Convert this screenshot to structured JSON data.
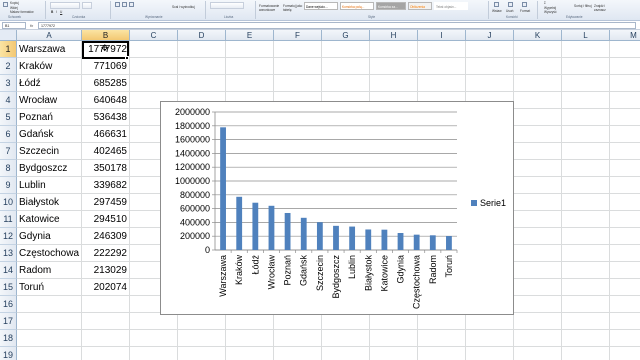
{
  "ribbon": {
    "clipboard_items": [
      "Kopiuj",
      "Wklej",
      "Malarz formatów"
    ],
    "group_labels": [
      "Schowek",
      "Czcionka",
      "Wyrównanie",
      "Liczba",
      "Style",
      "Komórki",
      "Edytowanie"
    ],
    "wrap_text": "Scal i wyśrodkuj",
    "conditional_formatting": "Formatowanie warunkowe",
    "format_as_table": "Formatuj jako tabelę",
    "styles": [
      "Dane wejścio...",
      "Komórka połą...",
      "Komórka za...",
      "Obliczenia",
      "Tekst objaśn..."
    ],
    "cells_buttons": [
      "Wstaw",
      "Usuń",
      "Format"
    ],
    "editing_items": [
      "Wypełnij",
      "Wyczyść",
      "Sortuj i filtruj",
      "Znajdź i zaznacz"
    ]
  },
  "formula_bar": {
    "name_box": "B1",
    "fx": "fx",
    "value": "1777972"
  },
  "grid": {
    "columns": [
      "A",
      "B",
      "C",
      "D",
      "E",
      "F",
      "G",
      "H",
      "I",
      "J",
      "K",
      "L",
      "M"
    ],
    "rows": [
      "1",
      "2",
      "3",
      "4",
      "5",
      "6",
      "7",
      "8",
      "9",
      "10",
      "11",
      "12",
      "13",
      "14",
      "15",
      "16",
      "17",
      "18",
      "19"
    ],
    "data": [
      {
        "city": "Warszawa",
        "value": "1777972"
      },
      {
        "city": "Kraków",
        "value": "771069"
      },
      {
        "city": "Łódź",
        "value": "685285"
      },
      {
        "city": "Wrocław",
        "value": "640648"
      },
      {
        "city": "Poznań",
        "value": "536438"
      },
      {
        "city": "Gdańsk",
        "value": "466631"
      },
      {
        "city": "Szczecin",
        "value": "402465"
      },
      {
        "city": "Bydgoszcz",
        "value": "350178"
      },
      {
        "city": "Lublin",
        "value": "339682"
      },
      {
        "city": "Białystok",
        "value": "297459"
      },
      {
        "city": "Katowice",
        "value": "294510"
      },
      {
        "city": "Gdynia",
        "value": "246309"
      },
      {
        "city": "Częstochowa",
        "value": "222292"
      },
      {
        "city": "Radom",
        "value": "213029"
      },
      {
        "city": "Toruń",
        "value": "202074"
      }
    ]
  },
  "colors": {
    "bar": "#4f81bd",
    "selected_header": "#f3c873",
    "header_text": "#27415f"
  },
  "chart_data": {
    "type": "bar",
    "categories": [
      "Warszawa",
      "Kraków",
      "Łódź",
      "Wrocław",
      "Poznań",
      "Gdańsk",
      "Szczecin",
      "Bydgoszcz",
      "Lublin",
      "Białystok",
      "Katowice",
      "Gdynia",
      "Częstochowa",
      "Radom",
      "Toruń"
    ],
    "series": [
      {
        "name": "Serie1",
        "values": [
          1777972,
          771069,
          685285,
          640648,
          536438,
          466631,
          402465,
          350178,
          339682,
          297459,
          294510,
          246309,
          222292,
          213029,
          202074
        ]
      }
    ],
    "yticks": [
      "0",
      "200000",
      "400000",
      "600000",
      "800000",
      "1000000",
      "1200000",
      "1400000",
      "1600000",
      "1800000",
      "2000000"
    ],
    "ylim": [
      0,
      2000000
    ],
    "grid": true,
    "legend_position": "right",
    "title": "",
    "xlabel": "",
    "ylabel": ""
  }
}
